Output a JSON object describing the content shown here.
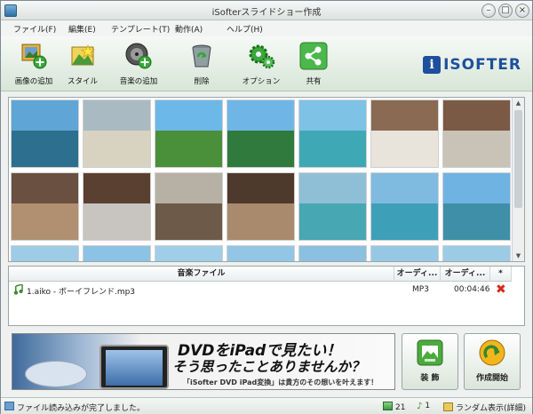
{
  "window": {
    "title": "iSofterスライドショー作成"
  },
  "menu": [
    "ファイル(F)",
    "編集(E)",
    "テンプレート(T)",
    "動作(A)",
    "ヘルプ(H)"
  ],
  "toolbar": {
    "add_image": "画像の追加",
    "style": "スタイル",
    "add_music": "音楽の追加",
    "delete": "削除",
    "options": "オプション",
    "share": "共有",
    "logo_text": "ISOFTER",
    "logo_badge": "i"
  },
  "music_list": {
    "columns": [
      "音楽ファイル",
      "オーディ...",
      "オーディ...",
      "*"
    ],
    "rows": [
      {
        "file": "1.aiko - ボーイフレンド.mp3",
        "format": "MP3",
        "duration": "00:04:46"
      }
    ]
  },
  "banner": {
    "line1": "DVDをiPadで見たい！",
    "line2": "そう思ったことありませんか？",
    "line3": "「iSofter DVD iPad変換」は貴方のその想いを叶えます！"
  },
  "buttons": {
    "decorate": "装 飾",
    "start": "作成開始"
  },
  "status": {
    "message": "ファイル読み込みが完了しました。",
    "image_count": "21",
    "music_count": "1",
    "display_mode": "ランダム表示(詳細)"
  },
  "thumbnails": [
    {
      "sky": "#5fa6d6",
      "sea": "#2d6f8f"
    },
    {
      "sky": "#a9bac2",
      "sea": "#d8d2c0"
    },
    {
      "sky": "#6cb8e8",
      "sea": "#4a8f3a"
    },
    {
      "sky": "#6fb6e6",
      "sea": "#2f7a3c"
    },
    {
      "sky": "#7ec2e6",
      "sea": "#3ea9b5"
    },
    {
      "sky": "#8a6a52",
      "sea": "#e8e4dc"
    },
    {
      "sky": "#7a5a44",
      "sea": "#c9c2b6"
    },
    {
      "sky": "#6a5040",
      "sea": "#b09070"
    },
    {
      "sky": "#5a4030",
      "sea": "#c8c4c0"
    },
    {
      "sky": "#b7b0a4",
      "sea": "#6d5a48"
    },
    {
      "sky": "#4d3a2c",
      "sea": "#a98a6c"
    },
    {
      "sky": "#8fbfd6",
      "sea": "#47a7b3"
    },
    {
      "sky": "#7fbbe0",
      "sea": "#3e9fb8"
    },
    {
      "sky": "#6fb3e2",
      "sea": "#3f8fa8"
    },
    {
      "sky": "#9ecbe6",
      "sea": "#6fb0d0"
    },
    {
      "sky": "#8cc2e4",
      "sea": "#5aa5c8"
    },
    {
      "sky": "#a0cde8",
      "sea": "#6fb6d4"
    },
    {
      "sky": "#93c6e4",
      "sea": "#4fb0b8"
    },
    {
      "sky": "#8cc0e0",
      "sea": "#45a8b8"
    },
    {
      "sky": "#96c8e6",
      "sea": "#4fa8c4"
    },
    {
      "sky": "#9ccbe6",
      "sea": "#55a9c8"
    }
  ]
}
